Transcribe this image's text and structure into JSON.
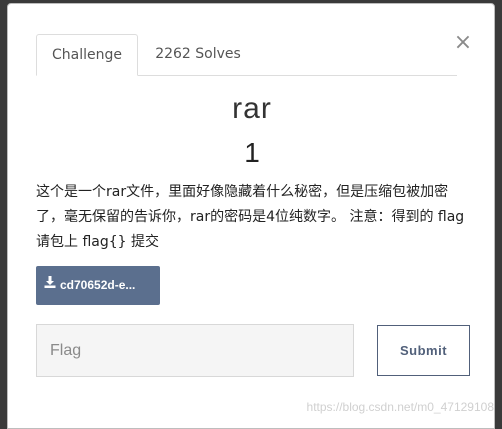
{
  "modal": {
    "close_icon": "close-icon",
    "tabs": [
      {
        "label": "Challenge",
        "active": true
      },
      {
        "label": "2262 Solves",
        "active": false
      }
    ],
    "challenge": {
      "name": "rar",
      "value": "1",
      "description": "这个是一个rar文件，里面好像隐藏着什么秘密，但是压缩包被加密了，毫无保留的告诉你，rar的密码是4位纯数字。 注意：得到的 flag 请包上 flag{} 提交",
      "file_label": "cd70652d-e...",
      "file_icon": "download-icon"
    },
    "flag_input": {
      "placeholder": "Flag",
      "value": ""
    },
    "submit_label": "Submit"
  },
  "watermark": "https://blog.csdn.net/m0_47129108",
  "colors": {
    "file_button_bg": "#5b6f8e",
    "submit_border": "#51607a",
    "backdrop": "#3a3a3a"
  }
}
